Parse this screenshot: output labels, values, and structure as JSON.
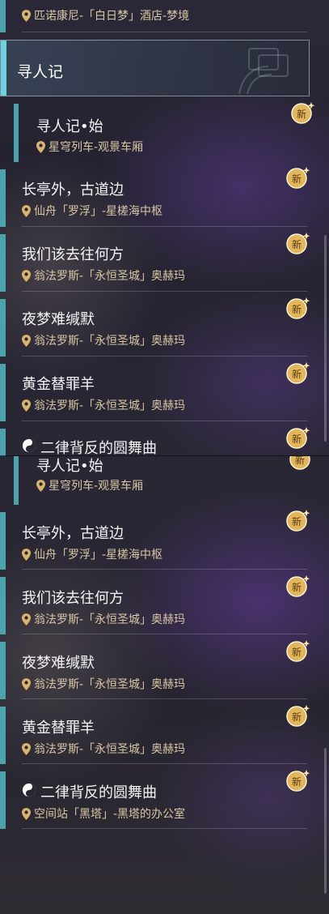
{
  "top": {
    "partial_item": {
      "location": "匹诺康尼-「白日梦」酒店-梦境"
    },
    "section": {
      "title": "寻人记"
    },
    "items": [
      {
        "title": "寻人记•始",
        "location": "星穹列车-观景车厢",
        "badge": "新"
      },
      {
        "title": "长亭外，古道边",
        "location": "仙舟「罗浮」-星槎海中枢",
        "badge": "新"
      },
      {
        "title": "我们该去往何方",
        "location": "翁法罗斯-「永恒圣城」奥赫玛",
        "badge": "新"
      },
      {
        "title": "夜梦难缄默",
        "location": "翁法罗斯-「永恒圣城」奥赫玛",
        "badge": "新"
      },
      {
        "title": "黄金替罪羊",
        "location": "翁法罗斯-「永恒圣城」奥赫玛",
        "badge": "新"
      },
      {
        "title": "二律背反的圆舞曲",
        "location": "",
        "badge": "新"
      }
    ]
  },
  "bottom": {
    "items": [
      {
        "title": "寻人记•始",
        "location": "星穹列车-观景车厢",
        "badge": "新"
      },
      {
        "title": "长亭外，古道边",
        "location": "仙舟「罗浮」-星槎海中枢",
        "badge": "新"
      },
      {
        "title": "我们该去往何方",
        "location": "翁法罗斯-「永恒圣城」奥赫玛",
        "badge": "新"
      },
      {
        "title": "夜梦难缄默",
        "location": "翁法罗斯-「永恒圣城」奥赫玛",
        "badge": "新"
      },
      {
        "title": "黄金替罪羊",
        "location": "翁法罗斯-「永恒圣城」奥赫玛",
        "badge": "新"
      },
      {
        "title": "二律背反的圆舞曲",
        "location": "空间站「黑塔」-黑塔的办公室",
        "badge": "新"
      }
    ]
  },
  "colors": {
    "accent_bar": "#4aa3ae",
    "location_text": "#d7c8a4",
    "badge_gold": "#e2b65a"
  },
  "icons": {
    "location": "map-pin-icon",
    "new": "new-badge-icon",
    "special_quest": "yin-yang-icon"
  }
}
